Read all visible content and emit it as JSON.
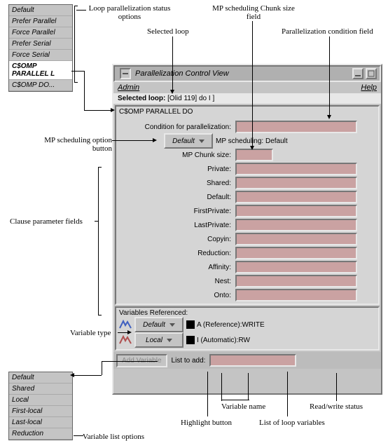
{
  "annotations": {
    "loop_option_list": "Loop parallelization status options",
    "selected_loop": "Selected loop",
    "chunk_field": "MP scheduling Chunk size field",
    "cond_field": "Parallelization condition field",
    "sched_btn": "MP scheduling option button",
    "clause_fields": "Clause parameter fields",
    "var_type": "Variable type",
    "var_list_options": "Variable list options",
    "highlight_btn": "Highlight button",
    "var_name": "Variable name",
    "loop_vars": "List of loop variables",
    "rw_status": "Read/write status"
  },
  "status_options": [
    "Default",
    "Prefer Parallel",
    "Force Parallel",
    "Prefer Serial",
    "Force Serial",
    "C$OMP PARALLEL L",
    "C$OMP DO..."
  ],
  "var_list_options": [
    "Default",
    "Shared",
    "Local",
    "First-local",
    "Last-local",
    "Reduction"
  ],
  "window": {
    "title": "Parallelization Control View",
    "menu_left": "Admin",
    "menu_right": "Help",
    "selected_loop_label": "Selected loop:",
    "selected_loop_value": "[Olid 119] do I ]",
    "directive": "C$OMP PARALLEL DO"
  },
  "mp": {
    "sched_btn": "Default",
    "sched_label": "MP scheduling:",
    "sched_value": "Default",
    "chunk_label": "MP Chunk size:"
  },
  "clauses": {
    "condition": "Condition for parallelization:",
    "items": [
      "Private:",
      "Shared:",
      "Default:",
      "FirstPrivate:",
      "LastPrivate:",
      "Copyin:",
      "Reduction:",
      "Affinity:",
      "Nest:",
      "Onto:"
    ]
  },
  "vars": {
    "heading": "Variables Referenced:",
    "rows": [
      {
        "btn": "Default",
        "name": "A (Reference):WRITE"
      },
      {
        "btn": "Local",
        "name": "I (Automatic):RW"
      }
    ],
    "add_btn": "Add Variable",
    "list_to_add": "List to add:"
  },
  "icons": {
    "minimize": "minimize-icon",
    "maximize": "maximize-icon",
    "menu": "menu-icon"
  }
}
